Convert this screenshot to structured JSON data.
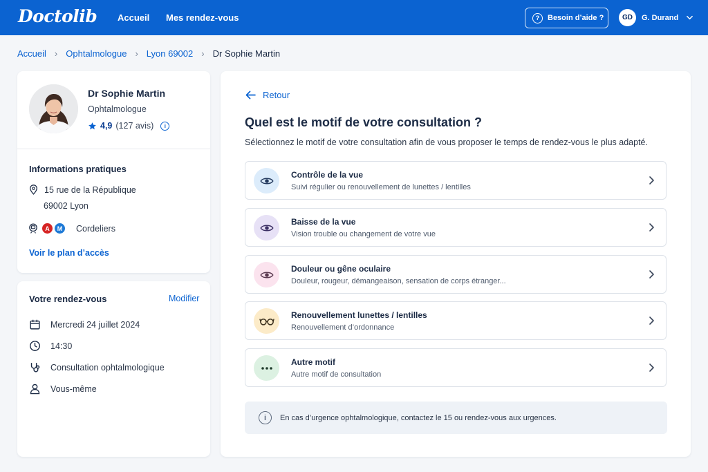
{
  "header": {
    "logo": "Doctolib",
    "nav": [
      "Accueil",
      "Mes rendez-vous"
    ],
    "help_label": "Besoin d’aide ?",
    "user_initials": "GD",
    "user_name": "G. Durand",
    "brand_color": "#0b63d1"
  },
  "breadcrumb": [
    "Accueil",
    "Ophtalmologue",
    "Lyon 69002",
    "Dr Sophie Martin"
  ],
  "doctor": {
    "name": "Dr Sophie Martin",
    "specialty": "Ophtalmologue",
    "rating": "4,9",
    "reviews": "(127 avis)"
  },
  "practical": {
    "title": "Informations pratiques",
    "address_line1": "15 rue de la République",
    "address_line2": "69002 Lyon",
    "metro_badges": [
      {
        "label": "A",
        "color": "#d62424"
      },
      {
        "label": "M",
        "color": "#1f7ad6"
      }
    ],
    "metro_station": "Cordeliers",
    "map_link": "Voir le plan d’accès"
  },
  "appointment": {
    "title": "Votre rendez-vous",
    "edit_label": "Modifier",
    "date": "Mercredi 24 juillet 2024",
    "time": "14:30",
    "type": "Consultation ophtalmologique",
    "patient": "Vous-même"
  },
  "main": {
    "back_label": "Retour",
    "title": "Quel est le motif de votre consultation ?",
    "subtitle": "Sélectionnez le motif de votre consultation afin de vous proposer le temps de rendez-vous le plus adapté.",
    "options": [
      {
        "title": "Contrôle de la vue",
        "desc": "Suivi régulier ou renouvellement de lunettes / lentilles",
        "icon": "eye-icon",
        "bg": "#dcecfb"
      },
      {
        "title": "Baisse de la vue",
        "desc": "Vision trouble ou changement de votre vue",
        "icon": "eye-icon",
        "bg": "#e7e1f6"
      },
      {
        "title": "Douleur ou gêne oculaire",
        "desc": "Douleur, rougeur, démangeaison, sensation de corps étranger...",
        "icon": "eye-icon",
        "bg": "#fbe3ee"
      },
      {
        "title": "Renouvellement lunettes / lentilles",
        "desc": "Renouvellement d’ordonnance",
        "icon": "glasses-icon",
        "bg": "#fcebc8"
      },
      {
        "title": "Autre motif",
        "desc": "Autre motif de consultation",
        "icon": "more-dots-icon",
        "bg": "#dcf1e2"
      }
    ],
    "notice": "En cas d’urgence ophtalmologique, contactez le 15 ou rendez-vous aux urgences."
  }
}
